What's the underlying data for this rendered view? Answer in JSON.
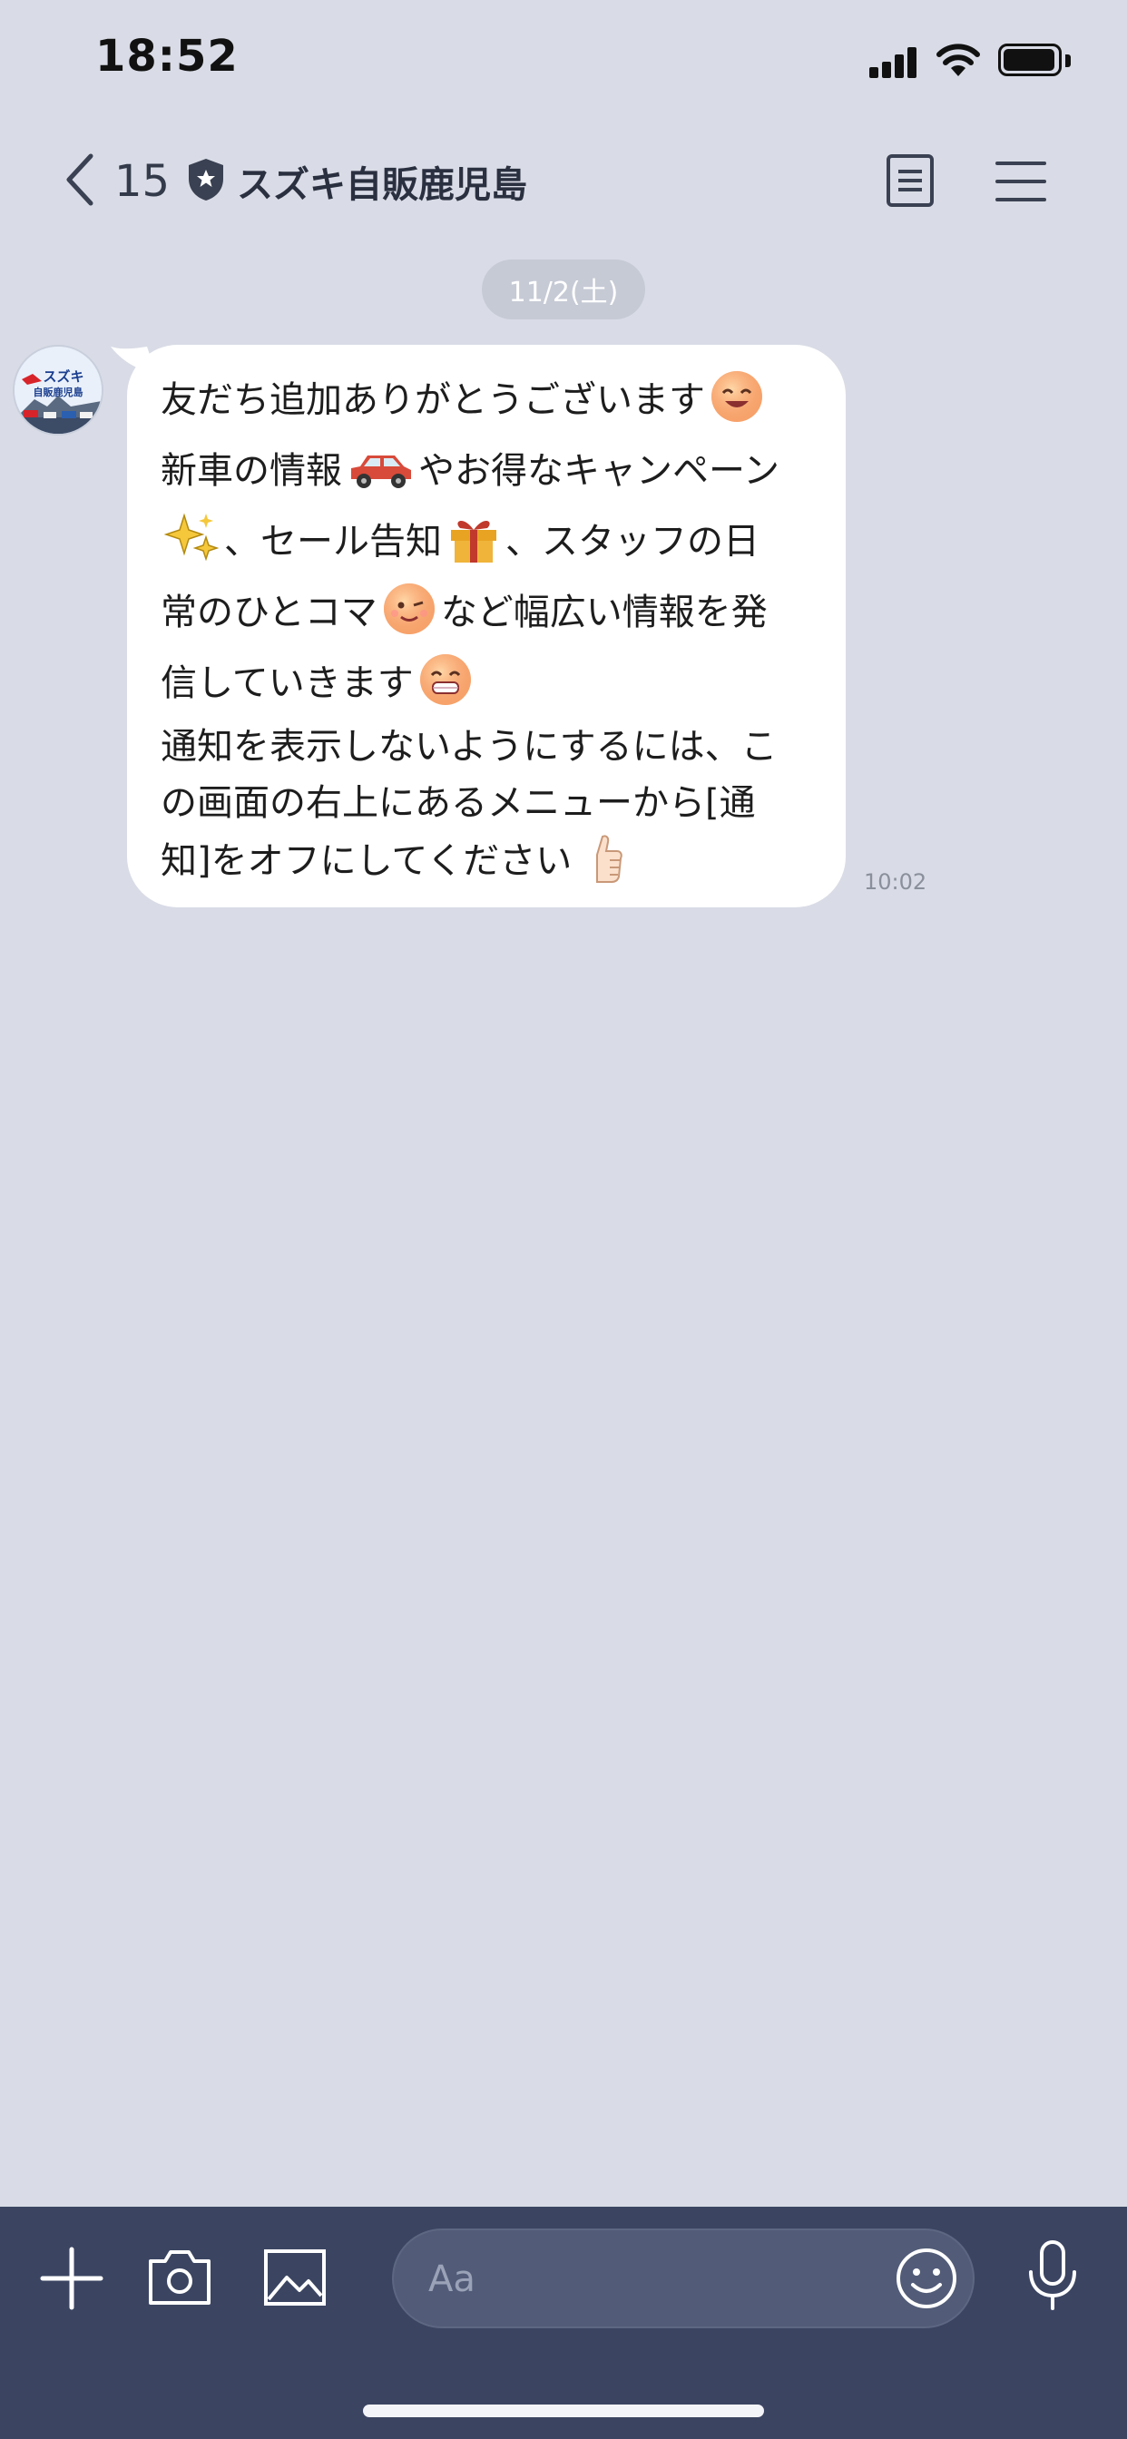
{
  "status_bar": {
    "time": "18:52",
    "icons": [
      "signal-icon",
      "wifi-icon",
      "battery-icon"
    ]
  },
  "header": {
    "back_count": "15",
    "title": "スズキ自販鹿児島",
    "icons": [
      "back-chevron-icon",
      "verified-shield-icon",
      "notes-icon",
      "menu-icon"
    ]
  },
  "chat": {
    "date_label": "11/2(土)",
    "avatar": {
      "logo_text": "スズキ",
      "sub_text": "自販鹿児島"
    },
    "message": {
      "line1": "友だち追加ありがとうございます",
      "line2_a": "新車の情報",
      "line2_b": "やお得なキャンペーン",
      "line3_a": "、セール告知",
      "line3_b": "、スタッフの日",
      "line4_a": "常のひとコマ",
      "line4_b": "など幅広い情報を発",
      "line5": "信していきます",
      "line6": "通知を表示しないようにするには、こ",
      "line7": "の画面の右上にあるメニューから[通",
      "line8": "知]をオフにしてください",
      "emojis": [
        "smile-emoji",
        "car-emoji",
        "sparkles-emoji",
        "gift-emoji",
        "wink-emoji",
        "grin-emoji",
        "thumbs-up-emoji"
      ],
      "time": "10:02"
    }
  },
  "composer": {
    "placeholder": "Aa",
    "icons": [
      "plus-icon",
      "camera-icon",
      "image-icon",
      "emoji-icon",
      "microphone-icon"
    ]
  },
  "colors": {
    "background": "#d9dce6",
    "bubble": "#ffffff",
    "composer_bar": "#3b4562",
    "input_box": "#525c78"
  }
}
